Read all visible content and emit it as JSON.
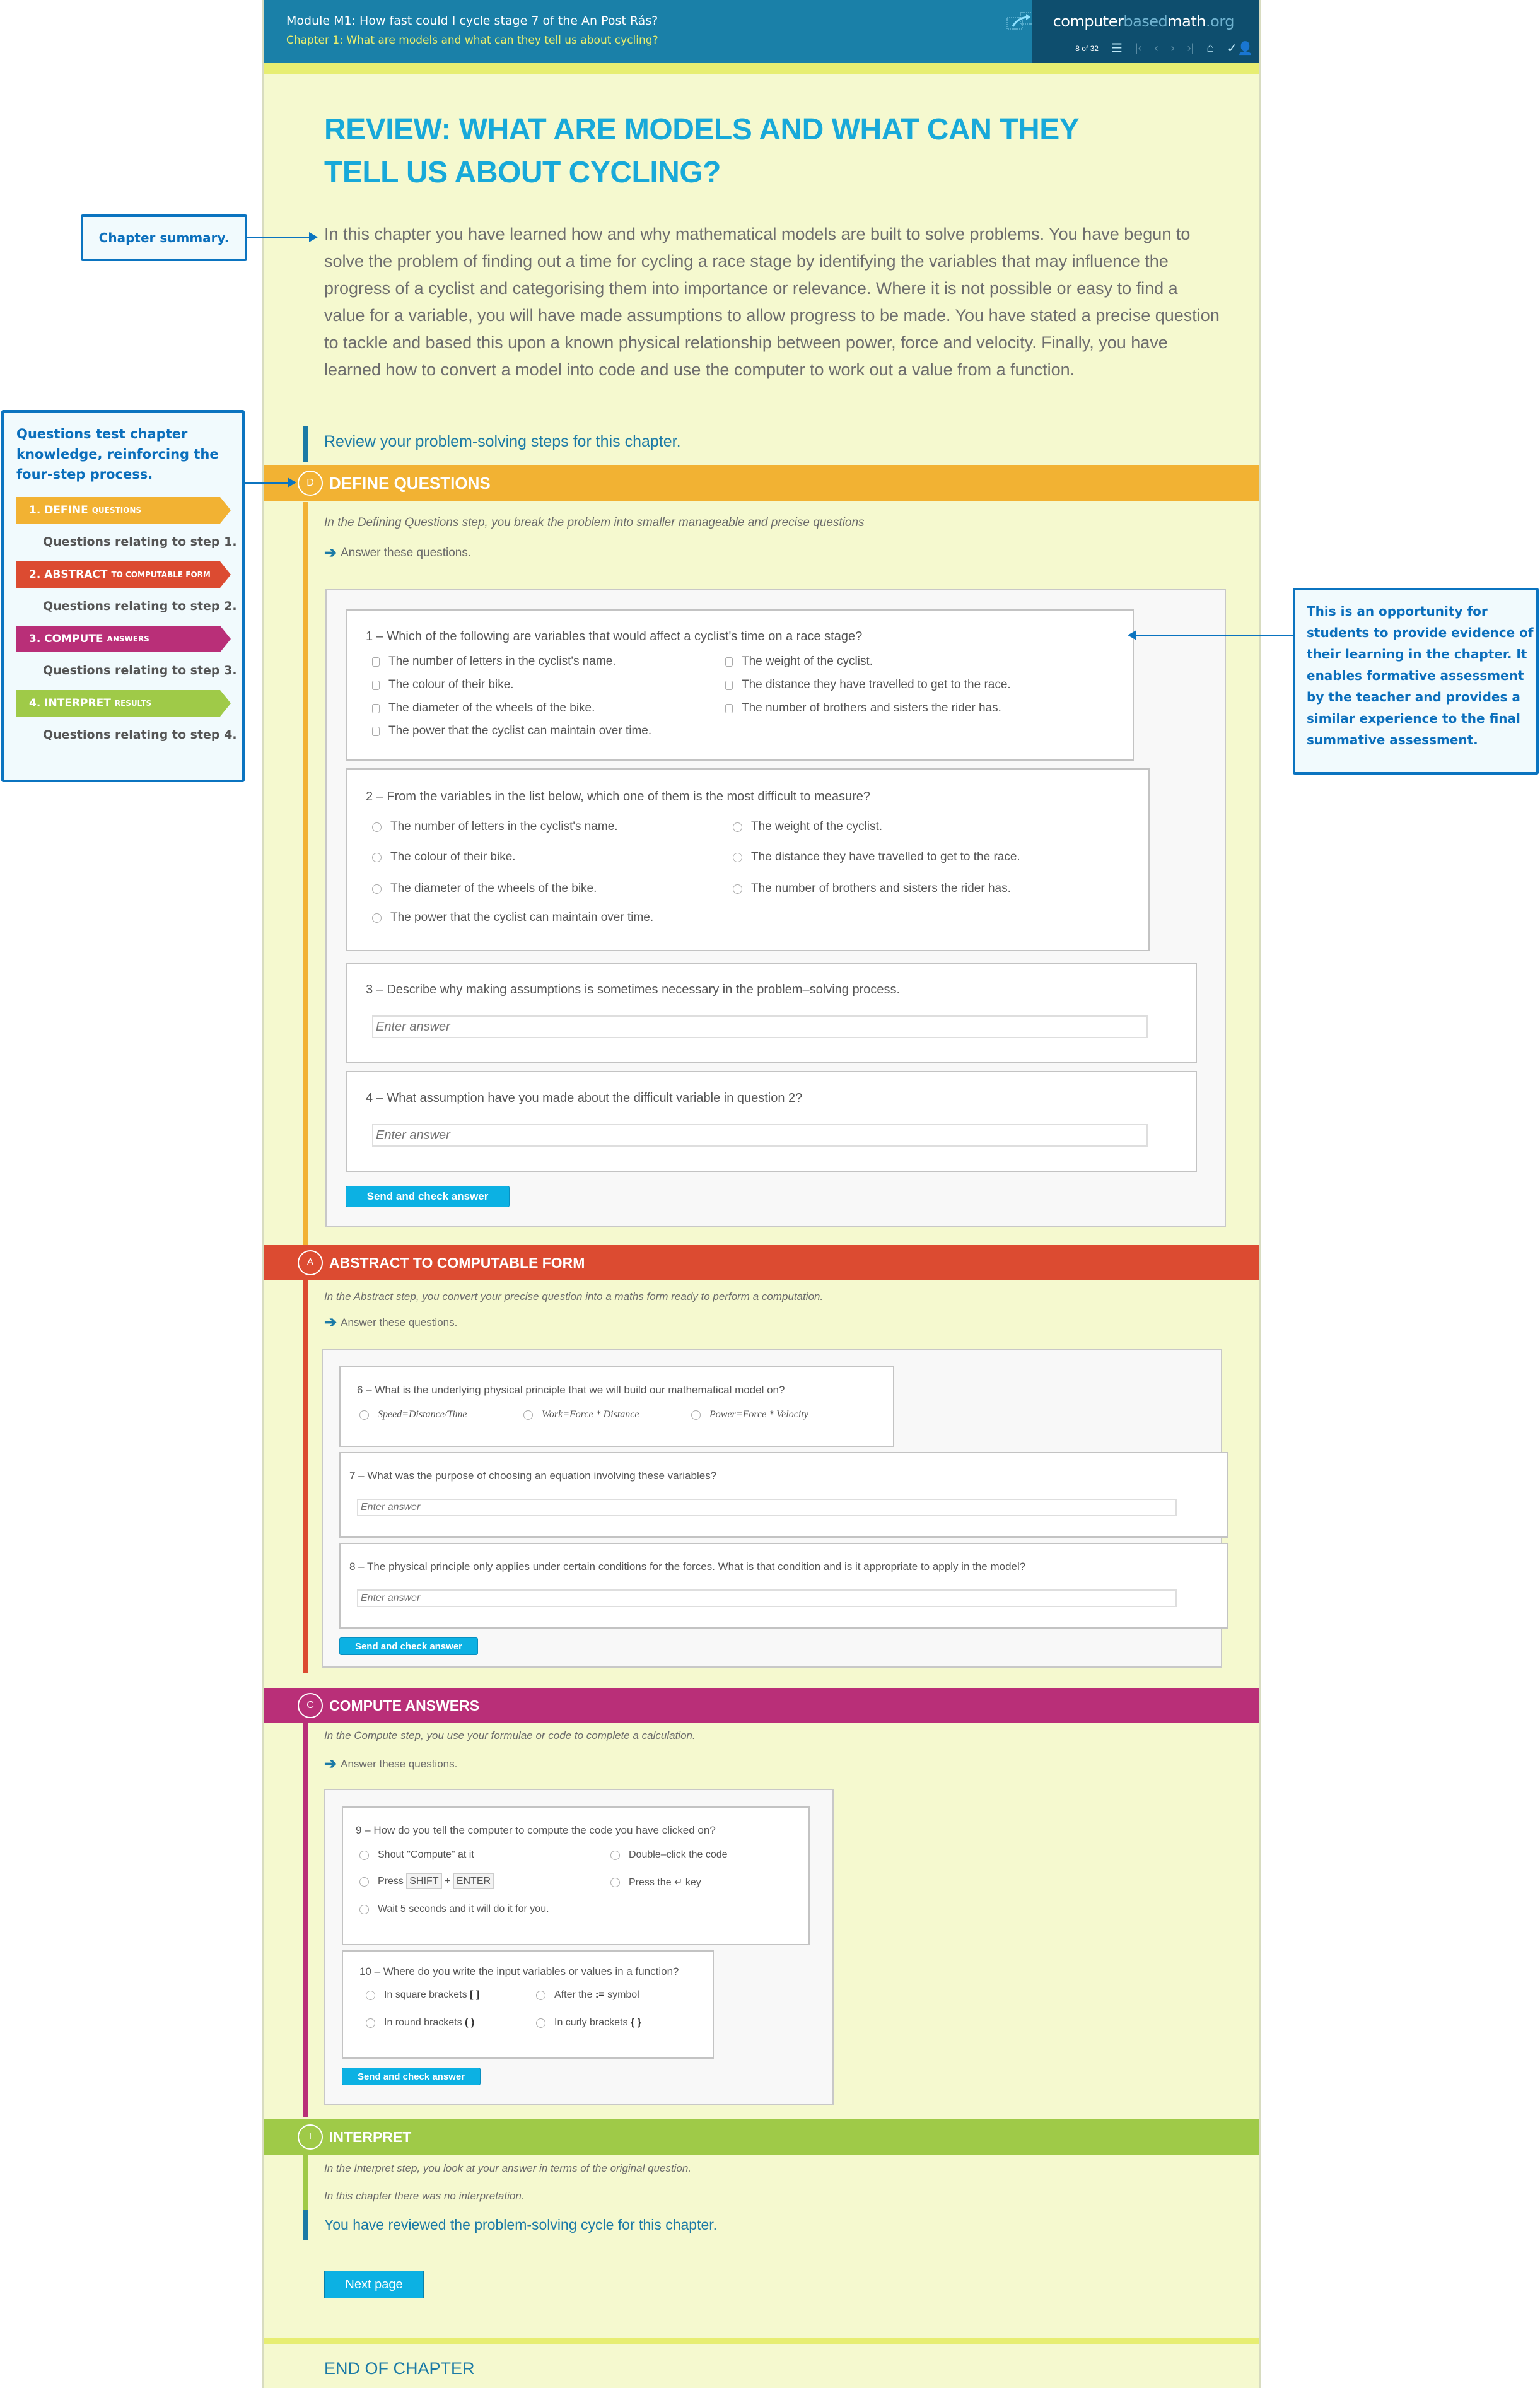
{
  "header": {
    "module_title": "Module M1: How fast could I cycle stage 7 of the An Post Rás?",
    "chapter_title": "Chapter 1: What are models and what can they tell us about cycling?",
    "logo": {
      "part1": "computer",
      "part2": "based",
      "part3": "math",
      "part4": ".org"
    },
    "page_indicator": "8 of 32",
    "icons": [
      "share-icon",
      "list-icon",
      "first-page-icon",
      "prev-page-icon",
      "next-page-icon",
      "last-page-icon",
      "home-icon",
      "user-icon"
    ]
  },
  "page": {
    "title": "REVIEW: WHAT ARE MODELS AND WHAT CAN THEY TELL US ABOUT CYCLING?",
    "summary": "In this chapter you have learned how and why mathematical models are built to solve problems. You have begun to solve the problem of finding out a time for cycling a race stage by identifying the variables that may influence the progress of a cyclist and categorising them into importance or relevance. Where it is not possible or easy to find a value for a variable, you will have made assumptions to allow progress to be made. You have stated a precise question to tackle and based this upon a known physical relationship between power, force and velocity. Finally, you have learned how to convert a model into code and use the computer to work out a value from a function.",
    "review_intro": "Review your problem-solving steps for this chapter.",
    "answer_prompt": "Answer these questions.",
    "send_label": "Send and check answer",
    "input_placeholder": "Enter answer",
    "final_message": "You have reviewed the problem-solving cycle for this chapter.",
    "next_label": "Next page",
    "end_label": "END OF CHAPTER"
  },
  "colors": {
    "define": "#f2b233",
    "abstract": "#dc4b31",
    "compute": "#b92f78",
    "interpret": "#9fca48",
    "accent_blue": "#1b7aa6",
    "button_blue": "#0cb1e3"
  },
  "sections": {
    "define": {
      "letter": "D",
      "label": "DEFINE QUESTIONS",
      "description": "In the Defining Questions step, you break the problem into smaller manageable and precise questions",
      "q1": {
        "text": "1 – Which of the following are variables that would affect a cyclist's time on a race stage?",
        "options": [
          "The number of letters in the cyclist's name.",
          "The colour of their bike.",
          "The diameter of the wheels of the bike.",
          "The power that the cyclist can maintain over time.",
          "The weight of the cyclist.",
          "The distance they have travelled to get to the race.",
          "The number of brothers and sisters the rider has."
        ]
      },
      "q2": {
        "text": "2 – From the variables in the list below, which one of them is the most difficult to measure?",
        "options": [
          "The number of letters in the cyclist's name.",
          "The colour of their bike.",
          "The diameter of the wheels of the bike.",
          "The power that the cyclist can maintain over time.",
          "The weight of the cyclist.",
          "The distance they have travelled to get to the race.",
          "The number of brothers and sisters the rider has."
        ]
      },
      "q3": {
        "text": "3 – Describe why making assumptions is sometimes necessary in the problem–solving process."
      },
      "q4": {
        "text": "4 – What assumption have you made about the difficult variable in question 2?"
      }
    },
    "abstract": {
      "letter": "A",
      "label": "ABSTRACT TO COMPUTABLE FORM",
      "description": "In the Abstract step, you convert your precise question into a maths form ready to perform a computation.",
      "q6": {
        "text": "6 – What is the underlying physical principle that we will build our mathematical model on?",
        "options": [
          "Speed=Distance/Time",
          "Work=Force * Distance",
          "Power=Force * Velocity"
        ]
      },
      "q7": {
        "text": "7 – What was the purpose of choosing an equation involving these variables?"
      },
      "q8": {
        "text": "8 – The physical principle only applies under certain conditions for the forces. What is that condition and is it appropriate to apply in the model?"
      }
    },
    "compute": {
      "letter": "C",
      "label": "COMPUTE ANSWERS",
      "description": "In the Compute step, you use your formulae or code to complete a calculation.",
      "q9": {
        "text": "9 – How do you tell the computer to compute the code you have clicked on?",
        "options": {
          "o1": "Shout \"Compute\" at it",
          "o2_prefix": "Press",
          "o2_key1": "SHIFT",
          "o2_plus": "+",
          "o2_key2": "ENTER",
          "o3": "Wait 5 seconds and it will do it for you.",
          "o4": "Double–click the code",
          "o5_prefix": "Press the",
          "o5_symbol": "↵",
          "o5_suffix": "key"
        }
      },
      "q10": {
        "text": "10 – Where do you write the input variables or values in a function?",
        "options": {
          "o1": "In square brackets",
          "o1_sym": "[ ]",
          "o2": "In round brackets",
          "o2_sym": "( )",
          "o3_prefix": "After the",
          "o3_sym": ":=",
          "o3_suffix": "symbol",
          "o4": "In curly brackets",
          "o4_sym": "{ }"
        }
      }
    },
    "interpret": {
      "letter": "I",
      "label": "INTERPRET",
      "description": "In the Interpret step, you look at your answer in terms of the original question.",
      "note": "In this chapter there was no interpretation."
    }
  },
  "callouts": {
    "chapter_summary": "Chapter summary.",
    "questions_test": "Questions test chapter knowledge, reinforcing the four-step process.",
    "steps": [
      {
        "main": "1. DEFINE",
        "sub": "QUESTIONS",
        "desc": "Questions relating to step 1."
      },
      {
        "main": "2. ABSTRACT",
        "sub": "TO COMPUTABLE FORM",
        "desc": "Questions relating to step 2."
      },
      {
        "main": "3. COMPUTE",
        "sub": "ANSWERS",
        "desc": "Questions relating to step 3."
      },
      {
        "main": "4. INTERPRET",
        "sub": "RESULTS",
        "desc": "Questions relating to step 4."
      }
    ],
    "opportunity": "This is an opportunity for students to provide evidence of their learning in the chapter. It enables formative assessment by the teacher and provides a similar experience to the final summative assessment."
  }
}
